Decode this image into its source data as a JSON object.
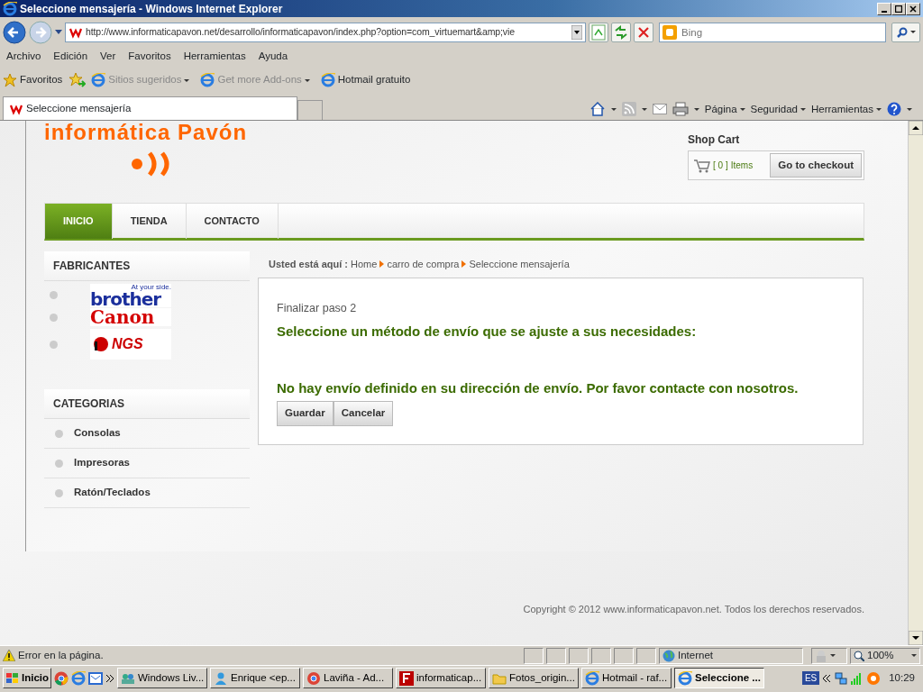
{
  "window": {
    "title": "Seleccione mensajería - Windows Internet Explorer"
  },
  "address_bar": {
    "url": "http://www.informaticapavon.net/desarrollo/informaticapavon/index.php?option=com_virtuemart&amp;vie",
    "search_placeholder": "Bing"
  },
  "menu_bar": [
    "Archivo",
    "Edición",
    "Ver",
    "Favoritos",
    "Herramientas",
    "Ayuda"
  ],
  "favorites_bar": {
    "favorites": "Favoritos",
    "links": [
      {
        "label": "Sitios sugeridos",
        "disabled": true,
        "dropdown": true
      },
      {
        "label": "Get more Add-ons",
        "disabled": true,
        "dropdown": true
      },
      {
        "label": "Hotmail gratuito",
        "disabled": false,
        "dropdown": false
      }
    ]
  },
  "tabs": [
    {
      "label": "Seleccione mensajería",
      "selected": true
    }
  ],
  "command_bar": [
    "Página",
    "Seguridad",
    "Herramientas"
  ],
  "site": {
    "logo": "informática Pavón",
    "shop_cart": {
      "title": "Shop Cart",
      "count": "[ 0 ]",
      "items_label": "Items",
      "checkout": "Go to checkout"
    },
    "nav": [
      {
        "label": "INICIO",
        "selected": true
      },
      {
        "label": "TIENDA",
        "selected": false
      },
      {
        "label": "CONTACTO",
        "selected": false
      }
    ],
    "manufacturers": {
      "title": "FABRICANTES",
      "items": [
        {
          "kind": "brother",
          "label": "brother",
          "tagline": "At your side."
        },
        {
          "kind": "canon",
          "label": "Canon"
        },
        {
          "kind": "ngs",
          "label": "NGS"
        }
      ]
    },
    "categories": {
      "title": "CATEGORIAS",
      "items": [
        "Consolas",
        "Impresoras",
        "Ratón/Teclados"
      ]
    },
    "breadcrumb": {
      "prefix": "Usted está aquí :",
      "items": [
        "Home",
        "carro de compra",
        "Seleccione mensajería"
      ]
    },
    "step": "Finalizar paso 2",
    "heading": "Seleccione un método de envío que se ajuste a sus necesidades:",
    "message": "No hay envío definido en su dirección de envío. Por favor contacte con nosotros.",
    "buttons": [
      "Guardar",
      "Cancelar"
    ],
    "footer": "Copyright © 2012 www.informaticapavon.net. Todos los derechos reservados."
  },
  "status_bar": {
    "message": "Error en la página.",
    "zone": "Internet",
    "zoom": "100%"
  },
  "taskbar": {
    "start": "Inicio",
    "items": [
      {
        "label": "Windows Liv...",
        "selected": false
      },
      {
        "label": "Enrique <ep...",
        "selected": false
      },
      {
        "label": "Laviña - Ad...",
        "selected": false
      },
      {
        "label": "informaticap...",
        "selected": false
      },
      {
        "label": "Fotos_origin...",
        "selected": false
      },
      {
        "label": "Hotmail - raf...",
        "selected": false
      },
      {
        "label": "Seleccione ...",
        "selected": true
      }
    ],
    "lang": "ES",
    "clock": "10:29"
  }
}
